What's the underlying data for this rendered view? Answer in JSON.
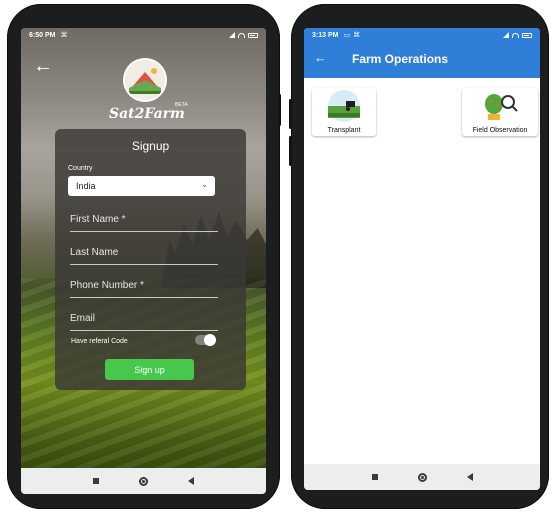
{
  "left_screen": {
    "status_time": "6:50 PM",
    "brand": "Sat2Farm",
    "beta_badge": "BETA",
    "signup": {
      "title": "Signup",
      "country_label": "Country",
      "country_value": "India",
      "first_name_placeholder": "First Name *",
      "last_name_placeholder": "Last Name",
      "phone_placeholder": "Phone Number *",
      "email_placeholder": "Email",
      "referral_label": "Have referal Code",
      "referral_toggle_on": true,
      "button_label": "Sign up"
    }
  },
  "right_screen": {
    "status_time": "3:13 PM",
    "title": "Farm Operations",
    "operations": [
      {
        "label": "Transplant",
        "icon": "tractor-field-icon"
      },
      {
        "label": "Field Observation",
        "icon": "magnifier-plant-icon"
      }
    ]
  },
  "colors": {
    "appbar_blue": "#2f7ed8",
    "signup_green": "#48c74d",
    "select_chevron": "#2b58b8"
  },
  "icons": {
    "back": "arrow-left-icon",
    "dropdown": "chevron-down-icon",
    "nav_recent": "square-icon",
    "nav_home": "circle-icon",
    "nav_back": "triangle-back-icon"
  }
}
